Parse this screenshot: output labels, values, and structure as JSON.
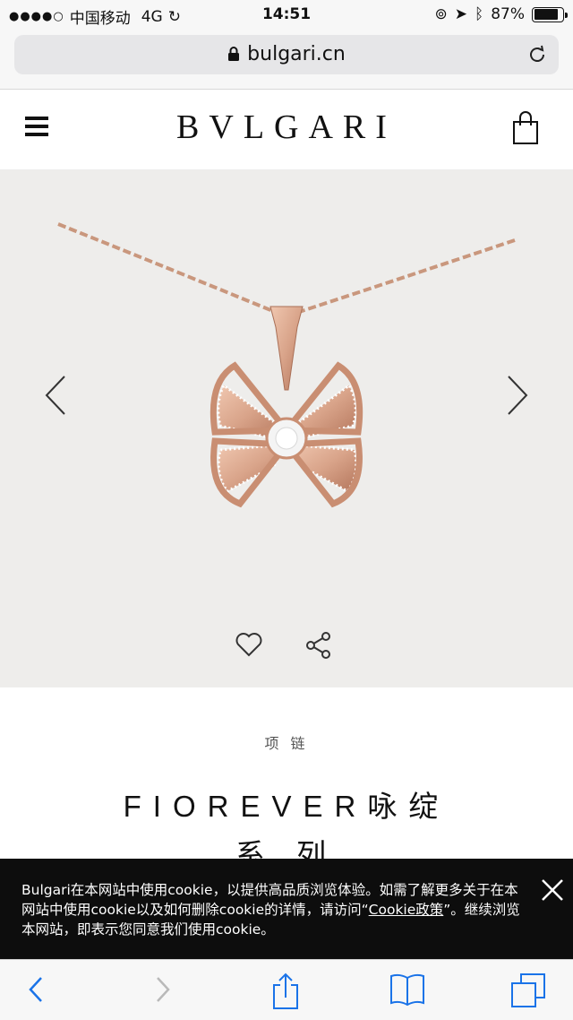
{
  "status_bar": {
    "carrier": "中国移动",
    "network": "4G",
    "time": "14:51",
    "battery": "87%",
    "battery_level": 0.87
  },
  "address_bar": {
    "url": "bulgari.cn"
  },
  "header": {
    "logo_text": "BVLGARI"
  },
  "product": {
    "category": "项 链",
    "title_line1": "FIOREVER咏绽",
    "title_line2": "系 列"
  },
  "cookie_banner": {
    "text_before": "Bulgari在本网站中使用cookie，以提供高品质浏览体验。如需了解更多关于在本网站中使用cookie以及如何删除cookie的详情，请访问“",
    "link_text": "Cookie政策",
    "text_after": "”。继续浏览本网站，即表示您同意我们使用cookie。"
  },
  "colors": {
    "hero_bg": "#eeedeb",
    "rose_gold": "#d9a48a",
    "ios_blue": "#1a73e8"
  },
  "icons": [
    "hamburger-menu-icon",
    "shopping-bag-icon",
    "chevron-left-icon",
    "chevron-right-icon",
    "heart-icon",
    "share-icon",
    "close-icon",
    "back-icon",
    "forward-icon",
    "share-upload-icon",
    "bookmarks-icon",
    "tabs-icon"
  ]
}
